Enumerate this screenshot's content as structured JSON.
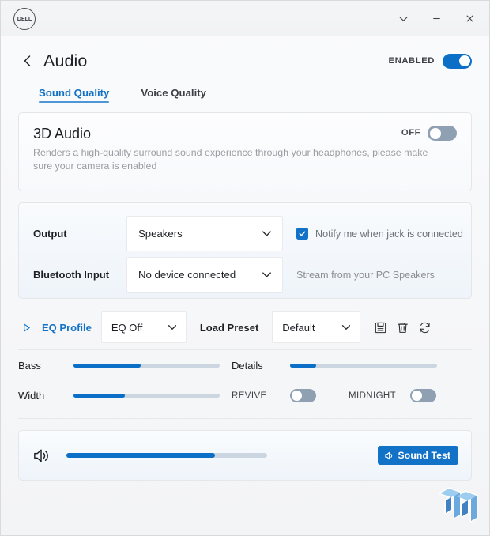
{
  "window": {
    "logo_text": "DELL",
    "controls": [
      {
        "name": "chevron-down-icon",
        "label": "Expand"
      },
      {
        "name": "minimize-icon",
        "label": "Minimize"
      },
      {
        "name": "close-icon",
        "label": "Close"
      }
    ]
  },
  "header": {
    "back_label": "Back",
    "title": "Audio",
    "enabled_label": "ENABLED",
    "enabled_state": "on"
  },
  "tabs": [
    {
      "label": "Sound Quality",
      "active": true
    },
    {
      "label": "Voice Quality",
      "active": false
    }
  ],
  "audio3d": {
    "title": "3D Audio",
    "description": "Renders a high-quality surround sound experience through your headphones, please make sure your camera is enabled",
    "toggle_label": "OFF",
    "toggle_state": "off"
  },
  "output": {
    "output_label": "Output",
    "output_value": "Speakers",
    "notify_label": "Notify me when jack is connected",
    "notify_checked": true,
    "bluetooth_label": "Bluetooth Input",
    "bluetooth_value": "No device connected",
    "bluetooth_note": "Stream from your PC Speakers"
  },
  "eq": {
    "expand_icon": "triangle-right-icon",
    "profile_label": "EQ Profile",
    "profile_value": "EQ Off",
    "load_preset_label": "Load Preset",
    "preset_value": "Default",
    "actions": [
      {
        "name": "save-icon",
        "label": "Save"
      },
      {
        "name": "delete-icon",
        "label": "Delete"
      },
      {
        "name": "reset-icon",
        "label": "Reset"
      }
    ]
  },
  "sliders": {
    "bass": {
      "label": "Bass",
      "value": 46
    },
    "details": {
      "label": "Details",
      "value": 18
    },
    "width": {
      "label": "Width",
      "value": 35
    },
    "revive": {
      "label": "REVIVE",
      "state": "off"
    },
    "midnight": {
      "label": "MIDNIGHT",
      "state": "off"
    }
  },
  "volume": {
    "icon": "speaker-icon",
    "value": 74,
    "sound_test_label": "Sound Test"
  },
  "watermark": {
    "name": "tweaktown-logo"
  },
  "colors": {
    "accent": "#0b6ec7",
    "accent_button": "#1272c8",
    "tab_active": "#1271c4",
    "toggle_off": "#8fa0b3",
    "track": "#ccd6e0",
    "muted_text": "#9a9da2"
  }
}
